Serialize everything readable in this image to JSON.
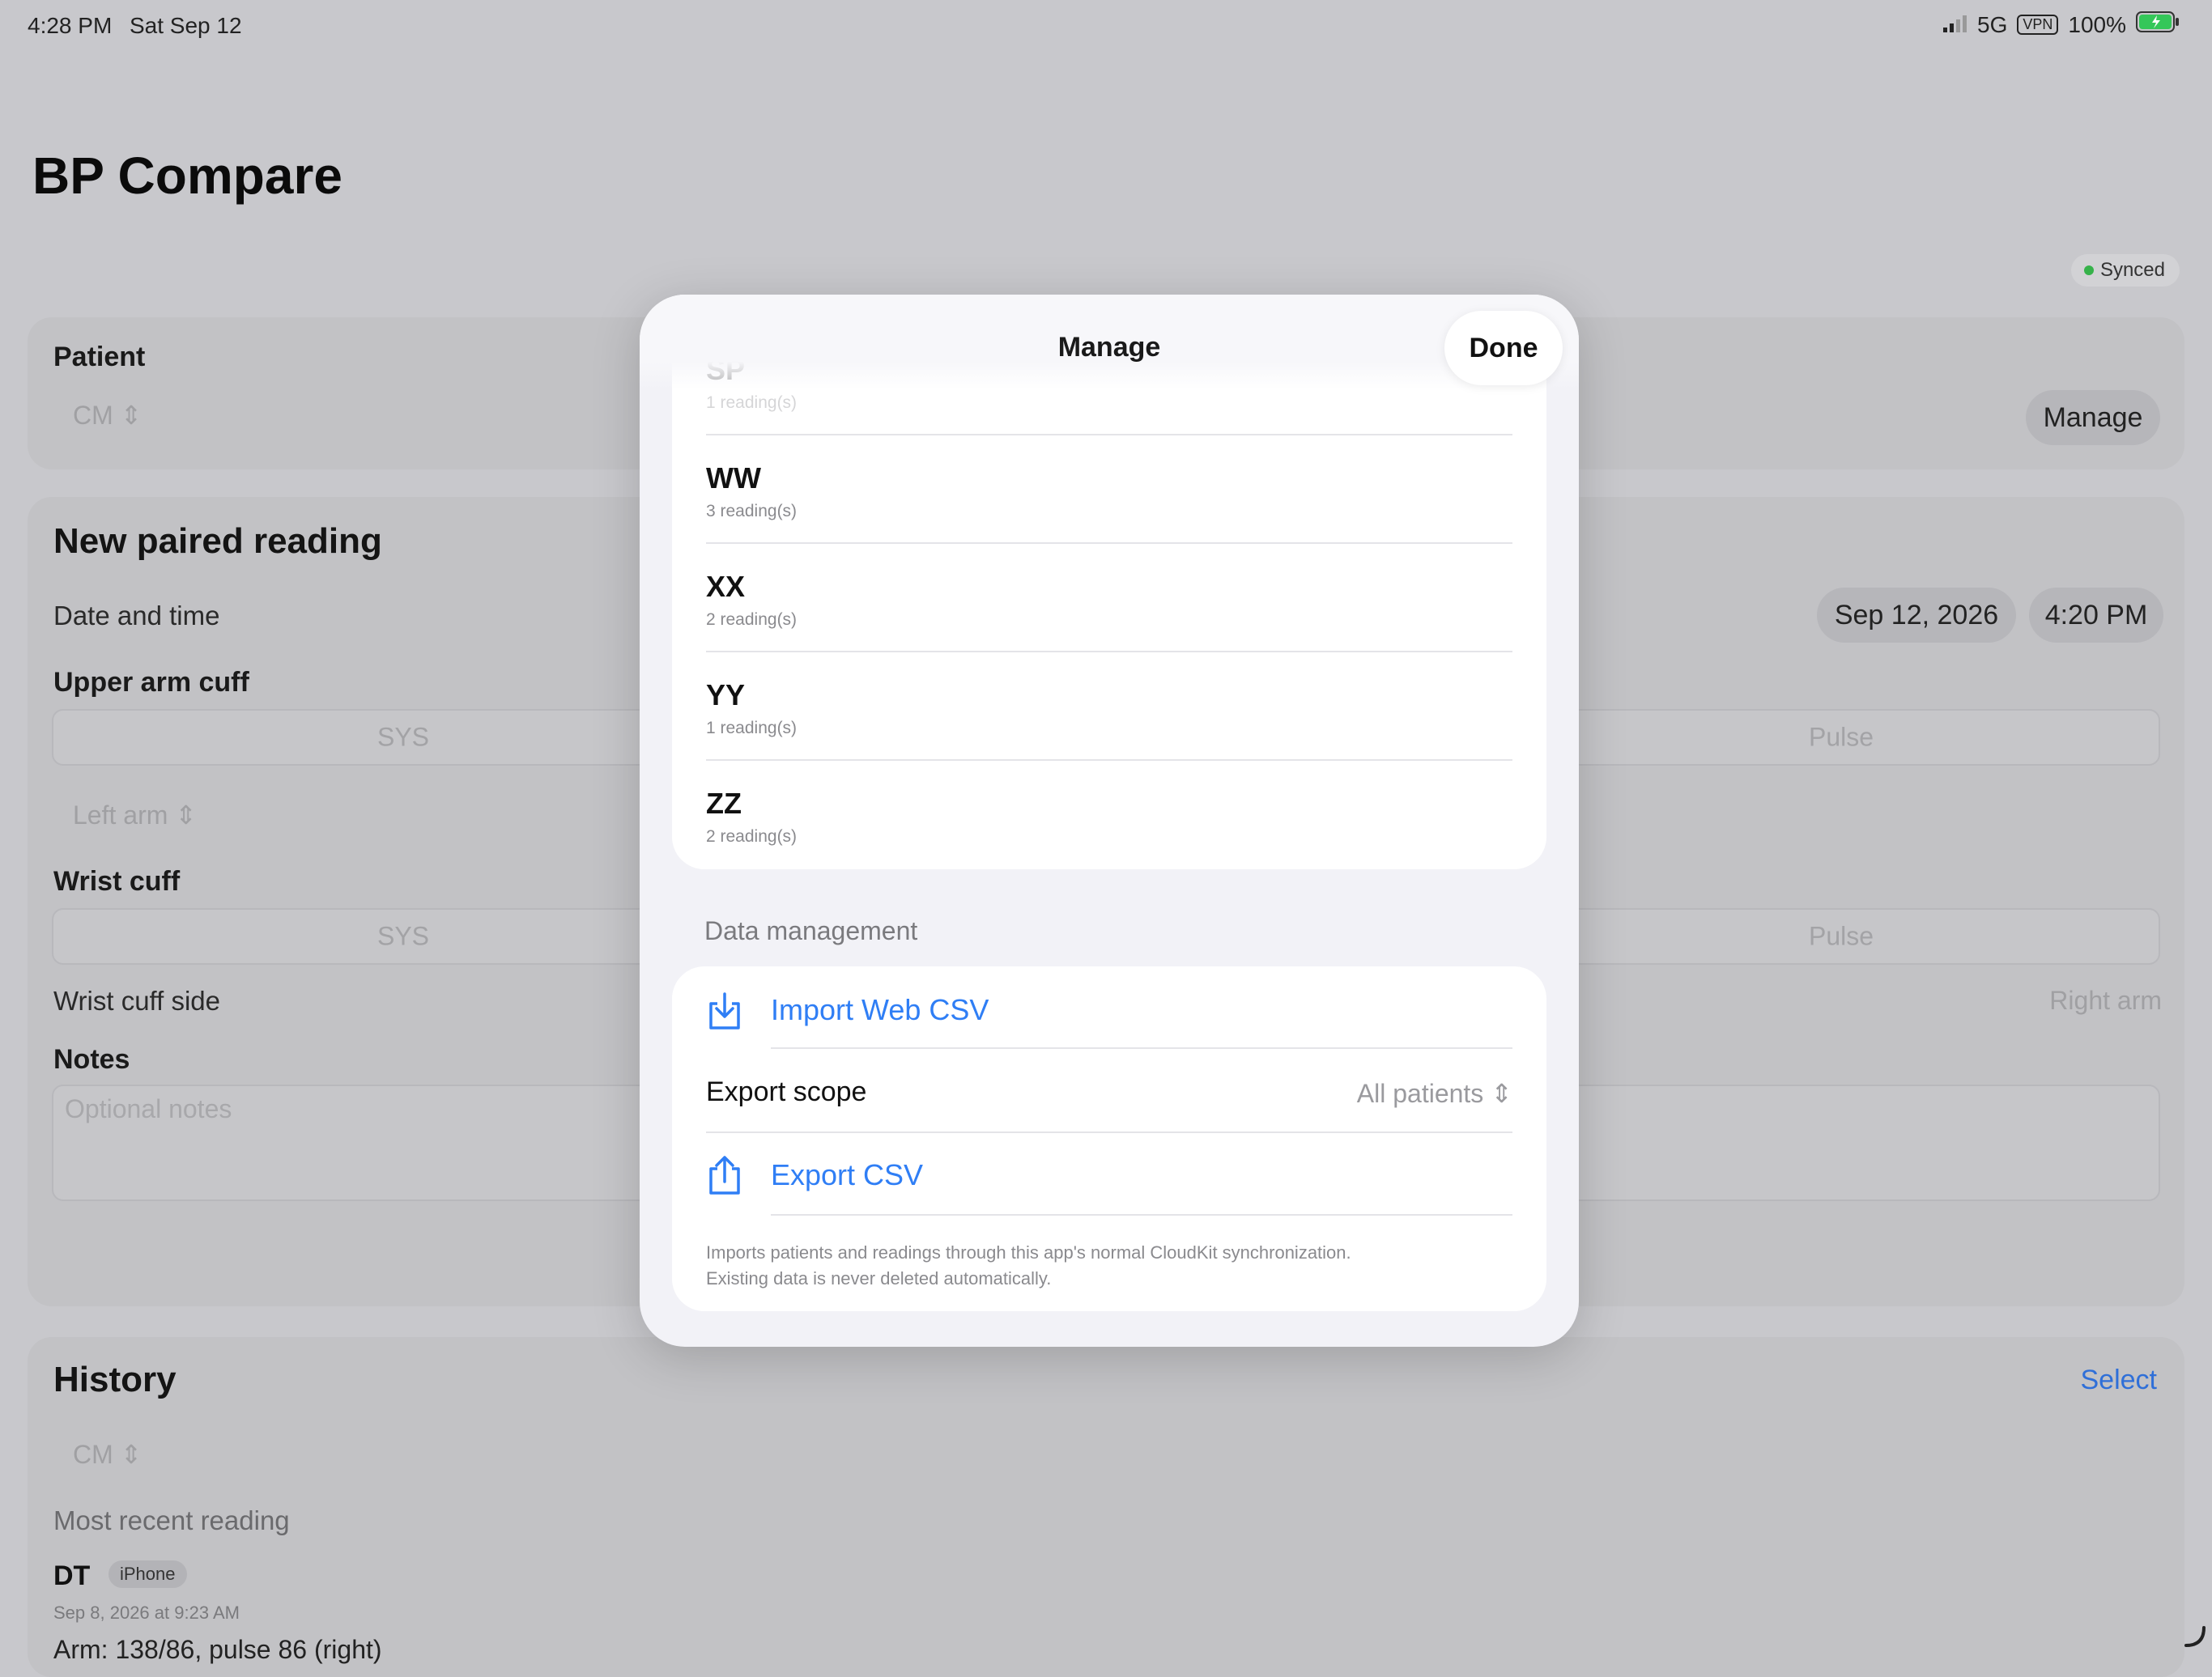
{
  "status_bar": {
    "time": "4:28 PM",
    "date": "Sat Sep 12",
    "network": "5G",
    "battery": "100%"
  },
  "app": {
    "title": "BP Compare",
    "sync_status": "Synced"
  },
  "patient_card": {
    "label": "Patient",
    "selected": "CM",
    "manage_button": "Manage"
  },
  "new_reading": {
    "heading": "New paired reading",
    "date_time_label": "Date and time",
    "date": "Sep 12, 2026",
    "time": "4:20 PM",
    "upper_arm_label": "Upper arm cuff",
    "upper_sys_placeholder": "SYS",
    "upper_pulse_placeholder": "Pulse",
    "arm_side": "Left arm",
    "wrist_label": "Wrist cuff",
    "wrist_sys_placeholder": "SYS",
    "wrist_pulse_placeholder": "Pulse",
    "wrist_side_label": "Wrist cuff side",
    "wrist_side_value": "Right arm",
    "notes_label": "Notes",
    "notes_placeholder": "Optional notes"
  },
  "history": {
    "heading": "History",
    "select_button": "Select",
    "patient_filter": "CM",
    "most_recent_label": "Most recent reading",
    "recent_name": "DT",
    "recent_device": "iPhone",
    "recent_date": "Sep 8, 2026 at 9:23 AM",
    "recent_values": "Arm: 138/86, pulse 86 (right)"
  },
  "modal": {
    "title": "Manage",
    "done_button": "Done",
    "patients": [
      {
        "name": "SP",
        "count": "1 reading(s)"
      },
      {
        "name": "WW",
        "count": "3 reading(s)"
      },
      {
        "name": "XX",
        "count": "2 reading(s)"
      },
      {
        "name": "YY",
        "count": "1 reading(s)"
      },
      {
        "name": "ZZ",
        "count": "2 reading(s)"
      }
    ],
    "data_management_header": "Data management",
    "import_label": "Import Web CSV",
    "export_scope_label": "Export scope",
    "export_scope_value": "All patients",
    "export_label": "Export CSV",
    "footnote_line1": "Imports patients and readings through this app's normal CloudKit synchronization.",
    "footnote_line2": "Existing data is never deleted automatically."
  },
  "colors": {
    "accent": "#2f7ef5",
    "synced_dot": "#36b24a",
    "background_dim": "#c8c8cc",
    "modal_bg": "#f2f2f7"
  }
}
